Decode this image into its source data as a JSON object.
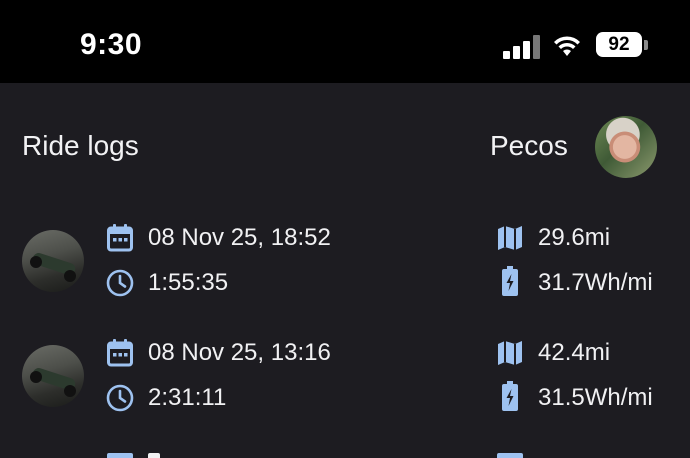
{
  "status_bar": {
    "time": "9:30",
    "battery_level": "92"
  },
  "header": {
    "title": "Ride logs",
    "user_name": "Pecos"
  },
  "colors": {
    "icon_accent": "#9ec2f0",
    "background": "#1d1c21",
    "status_bar": "#000000"
  },
  "icons": {
    "date": "calendar-icon",
    "duration": "clock-icon",
    "distance": "map-icon",
    "efficiency": "battery-charging-icon"
  },
  "rides": [
    {
      "date": "08 Nov 25, 18:52",
      "duration": "1:55:35",
      "distance": "29.6mi",
      "efficiency": "31.7Wh/mi"
    },
    {
      "date": "08 Nov 25, 13:16",
      "duration": "2:31:11",
      "distance": "42.4mi",
      "efficiency": "31.5Wh/mi"
    }
  ]
}
